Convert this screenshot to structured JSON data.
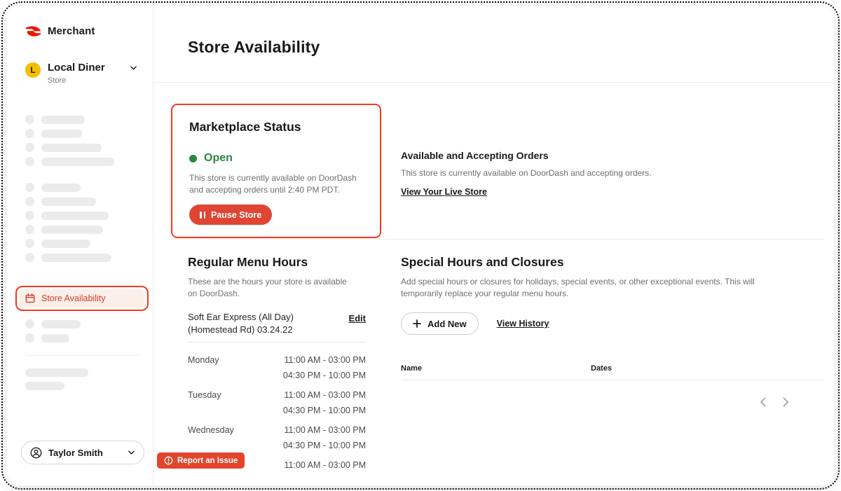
{
  "sidebar": {
    "brand": "Merchant",
    "store": {
      "initial": "L",
      "name": "Local Diner",
      "label": "Store"
    },
    "active_item": {
      "label": "Store Availability"
    },
    "user": {
      "name": "Taylor Smith"
    }
  },
  "report_issue_button": "Report an Issue",
  "page": {
    "title": "Store Availability"
  },
  "marketplace_status": {
    "heading": "Marketplace Status",
    "status_label": "Open",
    "description": "This store is currently available on DoorDash and accepting orders until 2:40 PM PDT.",
    "pause_button": "Pause Store"
  },
  "accepting_orders": {
    "heading": "Available and Accepting Orders",
    "description": "This store is currently available on DoorDash and accepting orders.",
    "live_store_link": "View Your Live Store"
  },
  "regular_menu_hours": {
    "heading": "Regular Menu Hours",
    "description": "These are the hours your store is available on DoorDash.",
    "menu_name": "Soft Ear Express (All Day) (Homestead Rd) 03.24.22",
    "edit_link": "Edit",
    "schedule": [
      {
        "day": "Monday",
        "times": [
          "11:00 AM - 03:00 PM",
          "04:30 PM - 10:00 PM"
        ]
      },
      {
        "day": "Tuesday",
        "times": [
          "11:00 AM - 03:00 PM",
          "04:30 PM - 10:00 PM"
        ]
      },
      {
        "day": "Wednesday",
        "times": [
          "11:00 AM - 03:00 PM",
          "04:30 PM - 10:00 PM"
        ]
      },
      {
        "day": "",
        "times": [
          "11:00 AM - 03:00 PM"
        ]
      }
    ]
  },
  "special_hours": {
    "heading": "Special Hours and Closures",
    "description": "Add special hours or closures for holidays, special events, or other exceptional events. This will temporarily replace your regular menu hours.",
    "add_new_button": "Add New",
    "view_history_link": "View History",
    "table_columns": [
      "Name",
      "Dates"
    ]
  },
  "colors": {
    "brand_red": "#EB1700",
    "highlight_red": "#F23A1E",
    "button_red": "#DF4532",
    "open_green": "#2E8540",
    "avatar_yellow": "#F6BE00"
  }
}
